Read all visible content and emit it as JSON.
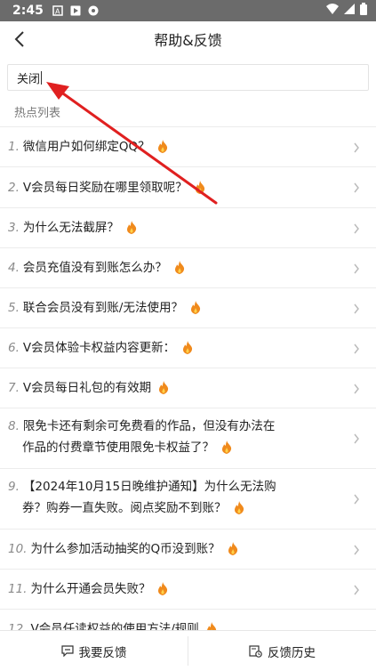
{
  "status_bar": {
    "time": "2:45",
    "icons": [
      "sim-icon",
      "play-icon",
      "shield-icon",
      "wifi-icon",
      "signal-icon",
      "battery-icon"
    ]
  },
  "header": {
    "title": "帮助&反馈",
    "back_icon": "chevron-left-icon"
  },
  "search": {
    "value": "关闭"
  },
  "section_label": "热点列表",
  "hot_list": [
    {
      "num": "1.",
      "text": "微信用户如何绑定QQ？"
    },
    {
      "num": "2.",
      "text": "V会员每日奖励在哪里领取呢？"
    },
    {
      "num": "3.",
      "text": "为什么无法截屏？"
    },
    {
      "num": "4.",
      "text": "会员充值没有到账怎么办？"
    },
    {
      "num": "5.",
      "text": "联合会员没有到账/无法使用？"
    },
    {
      "num": "6.",
      "text": "V会员体验卡权益内容更新："
    },
    {
      "num": "7.",
      "text": "V会员每日礼包的有效期"
    },
    {
      "num": "8.",
      "text": "限免卡还有剩余可免费看的作品，但没有办法在",
      "text2": "作品的付费章节使用限免卡权益了？"
    },
    {
      "num": "9.",
      "text": "【2024年10月15日晚维护通知】为什么无法购",
      "text2": "券？购券一直失败。阅点奖励不到账？"
    },
    {
      "num": "10.",
      "text": "为什么参加活动抽奖的Q币没到账？"
    },
    {
      "num": "11.",
      "text": "为什么开通会员失败？"
    },
    {
      "num": "12.",
      "text": "V会员任读权益的使用方法/规则"
    }
  ],
  "bottom_bar": {
    "feedback_label": "我要反馈",
    "history_label": "反馈历史"
  },
  "colors": {
    "fire": "#f08a1c",
    "arrow": "#e02020",
    "status_bar": "#6b6b6b"
  }
}
